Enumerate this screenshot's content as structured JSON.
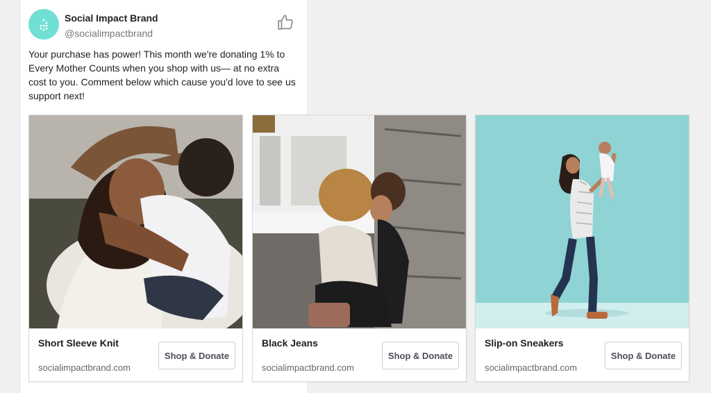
{
  "post": {
    "brand_name": "Social Impact Brand",
    "handle": "@socialimpactbrand",
    "text": "Your purchase has power! This month we're donating 1% to Every Mother Counts when you shop with us— at no extra cost to you. Comment below which cause you'd love to see us support next!"
  },
  "cards": [
    {
      "title": "Short Sleeve Knit",
      "url": "socialimpactbrand.com",
      "button_label": "Shop & Donate"
    },
    {
      "title": "Black Jeans",
      "url": "socialimpactbrand.com",
      "button_label": "Shop & Donate"
    },
    {
      "title": "Slip-on Sneakers",
      "url": "socialimpactbrand.com",
      "button_label": "Shop & Donate"
    }
  ],
  "colors": {
    "avatar": "#6fe0d3",
    "background": "#f0f0f0"
  },
  "icons": {
    "avatar": "dots-logo-icon",
    "like": "thumbs-up-icon"
  }
}
